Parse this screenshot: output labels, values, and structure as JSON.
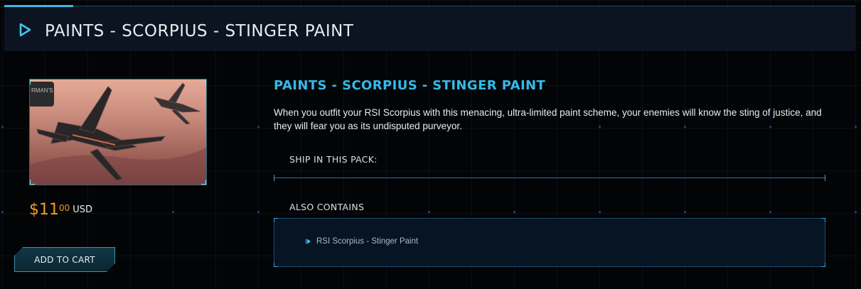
{
  "header": {
    "title": "PAINTS - SCORPIUS - STINGER PAINT"
  },
  "product": {
    "image_badge": "RMAN'S",
    "price": {
      "dollars": "$11",
      "cents": "00",
      "currency": "USD"
    },
    "add_to_cart_label": "ADD TO CART",
    "title": "PAINTS - SCORPIUS - STINGER PAINT",
    "description": "When you outfit your RSI Scorpius with this menacing, ultra-limited paint scheme, your enemies will know the sting of justice, and they will fear you as its undisputed purveyor.",
    "ship_section_label": "SHIP IN THIS PACK:",
    "also_contains_label": "ALSO CONTAINS",
    "also_contains_items": [
      {
        "label": "RSI Scorpius - Stinger Paint",
        "icon": "play-bullet-icon"
      }
    ]
  },
  "colors": {
    "accent": "#35b9e8",
    "price": "#f19a22",
    "header_bg": "#0b1420"
  }
}
